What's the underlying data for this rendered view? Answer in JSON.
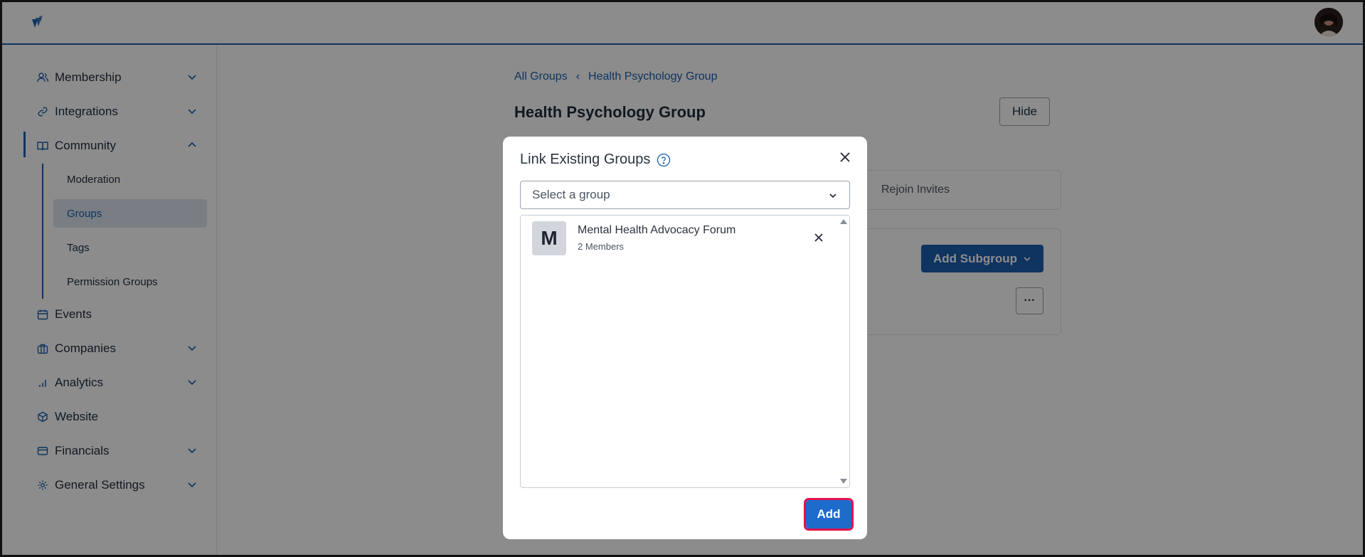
{
  "sidebar": {
    "items": [
      {
        "label": "Membership",
        "icon": "users-icon",
        "expandable": true
      },
      {
        "label": "Integrations",
        "icon": "link-icon",
        "expandable": true
      },
      {
        "label": "Community",
        "icon": "book-icon",
        "expandable": true,
        "expanded": true
      },
      {
        "label": "Events",
        "icon": "calendar-icon",
        "expandable": false
      },
      {
        "label": "Companies",
        "icon": "briefcase-icon",
        "expandable": true
      },
      {
        "label": "Analytics",
        "icon": "bar-chart-icon",
        "expandable": true
      },
      {
        "label": "Website",
        "icon": "cube-icon",
        "expandable": false
      },
      {
        "label": "Financials",
        "icon": "credit-card-icon",
        "expandable": true
      },
      {
        "label": "General Settings",
        "icon": "gear-icon",
        "expandable": true
      }
    ],
    "community_sub": [
      {
        "label": "Moderation"
      },
      {
        "label": "Groups",
        "active": true
      },
      {
        "label": "Tags"
      },
      {
        "label": "Permission Groups"
      }
    ]
  },
  "main": {
    "breadcrumb": {
      "root": "All Groups",
      "current": "Health Psychology Group"
    },
    "title": "Health Psychology Group",
    "hide_label": "Hide",
    "rejoin_tab": "Rejoin Invites",
    "add_subgroup_label": "Add Subgroup",
    "more_label": "···"
  },
  "modal": {
    "title": "Link Existing Groups",
    "select_placeholder": "Select a group",
    "items": [
      {
        "initial": "M",
        "name": "Mental Health Advocacy Forum",
        "members": "2 Members"
      }
    ],
    "add_label": "Add"
  },
  "colors": {
    "accent": "#1d5fad",
    "primary_button": "#1d6ccc",
    "highlight": "#e0124f"
  }
}
